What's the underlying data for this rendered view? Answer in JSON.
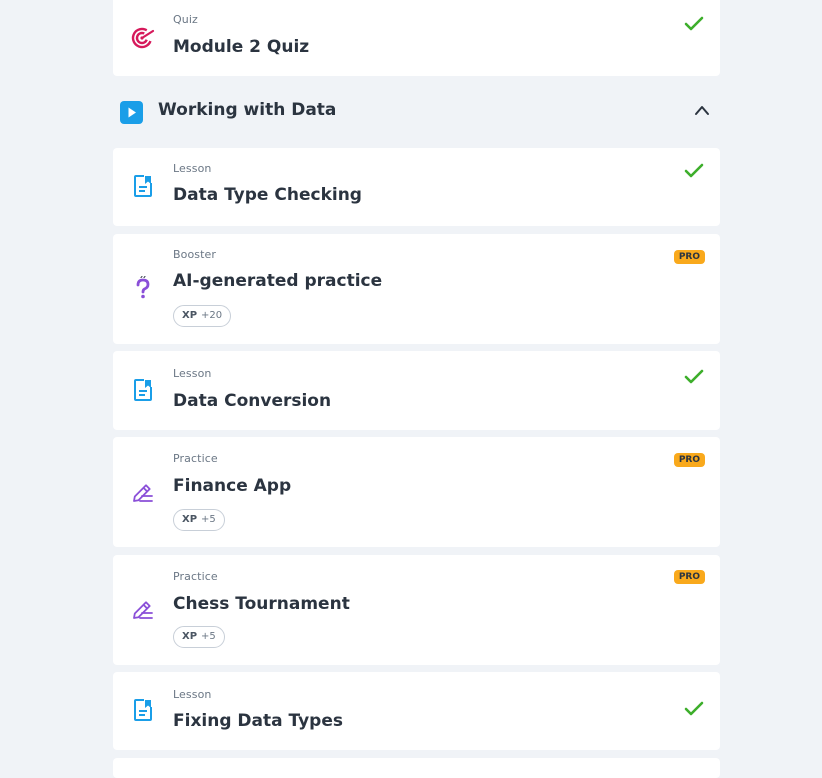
{
  "section": {
    "title": "Working with Data"
  },
  "items": [
    {
      "type": "Quiz",
      "title": "Module 2 Quiz",
      "icon": "target-icon",
      "completed": true
    },
    {
      "type": "Lesson",
      "title": "Data Type Checking",
      "icon": "lesson-document-icon",
      "completed": true
    },
    {
      "type": "Booster",
      "title": "AI-generated practice",
      "icon": "question-mark-icon",
      "pro": "PRO",
      "xp_label": "XP",
      "xp_value": "+20"
    },
    {
      "type": "Lesson",
      "title": "Data Conversion",
      "icon": "lesson-document-icon",
      "completed": true
    },
    {
      "type": "Practice",
      "title": "Finance App",
      "icon": "pencil-edit-icon",
      "pro": "PRO",
      "xp_label": "XP",
      "xp_value": "+5"
    },
    {
      "type": "Practice",
      "title": "Chess Tournament",
      "icon": "pencil-edit-icon",
      "pro": "PRO",
      "xp_label": "XP",
      "xp_value": "+5"
    },
    {
      "type": "Lesson",
      "title": "Fixing Data Types",
      "icon": "lesson-document-icon",
      "completed": true
    }
  ],
  "colors": {
    "background": "#f0f3f7",
    "check": "#3dae2b",
    "pro_badge": "#f9a91c",
    "lesson_icon": "#1a9ee8",
    "practice_icon": "#8a4fd8",
    "quiz_icon": "#d6195b",
    "section_play": "#1a9ee8"
  }
}
